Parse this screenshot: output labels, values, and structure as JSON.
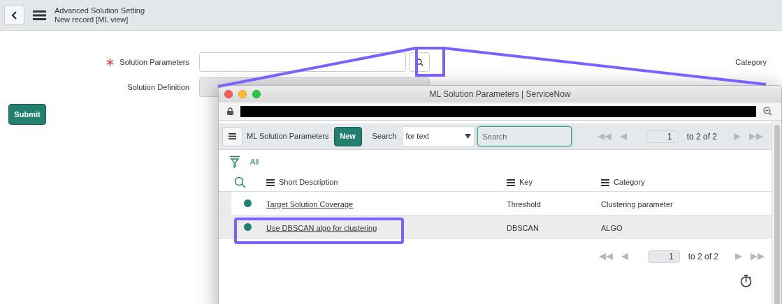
{
  "header": {
    "title": "Advanced Solution Setting",
    "subtitle": "New record [ML view]"
  },
  "form": {
    "fields": [
      {
        "label": "Solution Parameters",
        "required": true,
        "kind": "lookup"
      },
      {
        "label": "Solution Definition",
        "required": false,
        "kind": "readonly"
      }
    ],
    "right_label": "Category",
    "submit": "Submit"
  },
  "popup": {
    "title": "ML Solution Parameters | ServiceNow",
    "list_title": "ML Solution Parameters",
    "new_button": "New",
    "search_label": "Search",
    "search_select": "for text",
    "search": {
      "placeholder": "Search"
    },
    "pagination_top": {
      "page": "1",
      "range": "to 2 of 2"
    },
    "filter": "All",
    "columns": [
      "Short Description",
      "Key",
      "Category"
    ],
    "rows": [
      {
        "cells": [
          "Target Solution Coverage",
          "Threshold",
          "Clustering parameter"
        ],
        "highlighted": false
      },
      {
        "cells": [
          "Use DBSCAN algo for clustering",
          "DBSCAN",
          "ALGO"
        ],
        "highlighted": true
      }
    ],
    "pagination_bottom": {
      "page": "1",
      "range": "to 2 of 2"
    }
  }
}
